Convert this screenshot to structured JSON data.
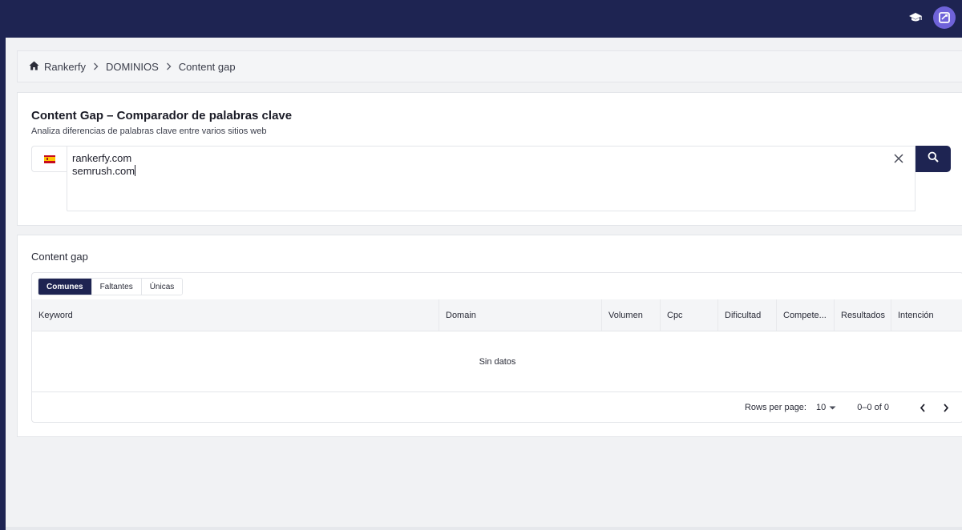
{
  "header": {
    "icons": [
      "graduation-cap-icon",
      "brand-logo-icon"
    ]
  },
  "breadcrumb": {
    "items": [
      "Rankerfy",
      "DOMINIOS",
      "Content gap"
    ]
  },
  "search": {
    "title": "Content Gap – Comparador de palabras clave",
    "subtitle": "Analiza diferencias de palabras clave entre varios sitios web",
    "country_flag": "spain-flag-icon",
    "domains": [
      "rankerfy.com",
      "semrush.com"
    ]
  },
  "results": {
    "title": "Content gap",
    "tabs": [
      {
        "label": "Comunes",
        "active": true
      },
      {
        "label": "Faltantes",
        "active": false
      },
      {
        "label": "Únicas",
        "active": false
      }
    ],
    "columns": [
      "Keyword",
      "Domain",
      "Volumen",
      "Cpc",
      "Dificultad",
      "Compete...",
      "Resultados",
      "Intención"
    ],
    "empty_text": "Sin datos",
    "pager": {
      "rows_label": "Rows per page:",
      "rows_value": "10",
      "range": "0–0 of 0"
    }
  },
  "colors": {
    "navy": "#1e2452",
    "accent": "#6f63d9"
  }
}
